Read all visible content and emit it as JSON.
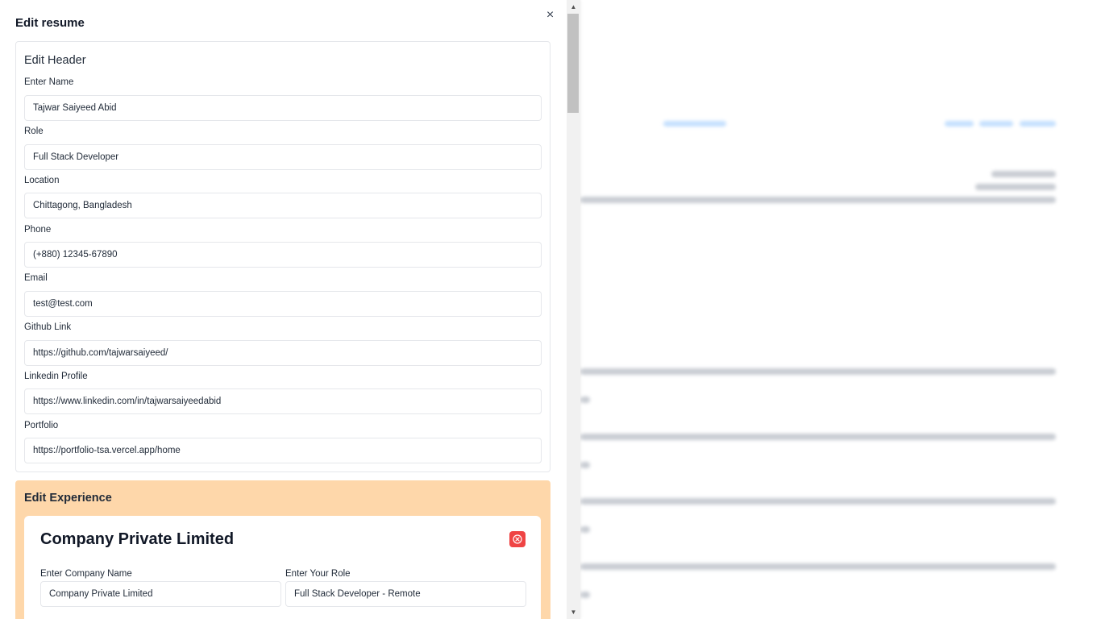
{
  "drawer": {
    "title": "Edit resume",
    "close_label": "×"
  },
  "header_section": {
    "title": "Edit Header",
    "fields": [
      {
        "label": "Enter Name",
        "value": "Tajwar Saiyeed Abid"
      },
      {
        "label": "Role",
        "value": "Full Stack Developer"
      },
      {
        "label": "Location",
        "value": "Chittagong, Bangladesh"
      },
      {
        "label": "Phone",
        "value": "(+880) 12345-67890"
      },
      {
        "label": "Email",
        "value": "test@test.com"
      },
      {
        "label": "Github Link",
        "value": "https://github.com/tajwarsaiyeed/"
      },
      {
        "label": "Linkedin Profile",
        "value": "https://www.linkedin.com/in/tajwarsaiyeedabid"
      },
      {
        "label": "Portfolio",
        "value": "https://portfolio-tsa.vercel.app/home"
      }
    ]
  },
  "experience_section": {
    "title": "Edit Experience",
    "entries": [
      {
        "heading": "Company Private Limited",
        "company_label": "Enter Company Name",
        "company_value": "Company Private Limited",
        "role_label": "Enter Your Role",
        "role_value": "Full Stack Developer - Remote"
      }
    ]
  },
  "scrollbar": {
    "up_arrow": "▲",
    "down_arrow": "▼"
  },
  "colors": {
    "experience_bg": "#fed7aa",
    "remove_button": "#ef4444",
    "border": "#e5e7eb"
  },
  "icons": {
    "close": "close-icon",
    "remove": "circle-x-icon"
  }
}
